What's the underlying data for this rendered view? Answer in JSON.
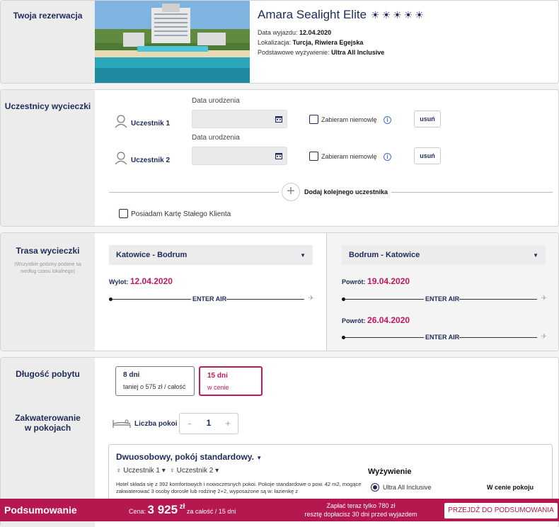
{
  "reservation": {
    "section_label": "Twoja rezerwacja",
    "hotel_name": "Amara Sealight Elite",
    "stars": 5,
    "departure_label": "Data wyjazdu:",
    "departure_value": "12.04.2020",
    "location_label": "Lokalizacja:",
    "location_value": "Turcja, Riwiera Egejska",
    "board_label": "Podstawowe wyżywienie:",
    "board_value": "Ultra All Inclusive"
  },
  "participants": {
    "section_label": "Uczestnicy wycieczki",
    "list": [
      {
        "name": "Uczestnik 1",
        "dob_label": "Data urodzenia",
        "infant_label": "Zabieram niemowlę",
        "remove_label": "usuń"
      },
      {
        "name": "Uczestnik 2",
        "dob_label": "Data urodzenia",
        "infant_label": "Zabieram niemowlę",
        "remove_label": "usuń"
      }
    ],
    "add_label": "Dodaj kolejnego uczestnika",
    "loyalty_label": "Posiadam Kartę Stałego Klienta"
  },
  "route": {
    "section_label": "Trasa wycieczki",
    "section_sub": "(Wszystkie godziny podane są według czasu lokalnego)",
    "outbound_select": "Katowice - Bodrum",
    "return_select": "Bodrum - Katowice",
    "outbound_label": "Wylot:",
    "outbound_date": "12.04.2020",
    "return_label": "Powrót:",
    "return_dates": [
      "19.04.2020",
      "26.04.2020"
    ],
    "carrier": "ENTER AIR"
  },
  "stay": {
    "section_label": "Długość pobytu",
    "options": [
      {
        "days": "8 dni",
        "note": "taniej o 575 zł / całość"
      },
      {
        "days": "15 dni",
        "note": "w cenie"
      }
    ],
    "accommodation_label": "Zakwaterowanie w pokojach",
    "rooms_label": "Liczba pokoi",
    "rooms_value": "1",
    "minus": "-",
    "plus": "+",
    "room_title": "Dwuosobowy, pokój standardowy.",
    "room_participants": [
      "Uczestnik 1",
      "Uczestnik 2"
    ],
    "room_desc": "Hotel składa się z 392 komfortowych i nowoczesnych pokoi. Pokoje standardowe o pow. 42 m2, mogące zakwaterować 3 osoby dorosłe lub rodzinę 2+2, wyposażone są w: łazienkę z",
    "board_title": "Wyżywienie",
    "board_option": "Ultra All Inclusive",
    "board_price": "W cenie pokoju"
  },
  "summary": {
    "title": "Podsumowanie",
    "price_label": "Cena:",
    "price": "3 925",
    "currency": "zł",
    "price_note": "za całość / 15 dni",
    "pay_now": "Zapłać teraz tylko 780 zł",
    "pay_rest": "resztę dopłacisz 30 dni przed wyjazdem",
    "cta": "PRZEJDŹ DO PODSUMOWANIA"
  },
  "colors": {
    "accent": "#c2185b",
    "navy": "#1e2a5a",
    "bar": "#b5174f"
  }
}
